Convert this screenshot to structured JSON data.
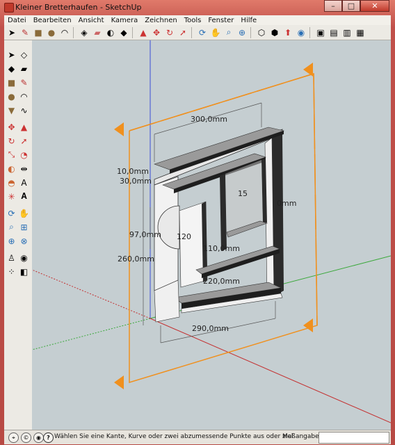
{
  "window": {
    "title": "Kleiner Bretterhaufen - SketchUp",
    "min": "–",
    "max": "□",
    "close": "✕"
  },
  "menu": [
    "Datei",
    "Bearbeiten",
    "Ansicht",
    "Kamera",
    "Zeichnen",
    "Tools",
    "Fenster",
    "Hilfe"
  ],
  "dimensions": {
    "width_top": "300,0mm",
    "thickness": "10,0mm",
    "offset": "30,0mm",
    "height_inner": "97,0mm",
    "height_total": "260,0mm",
    "depth": "120",
    "inner_width": "110,0mm",
    "shelf_width": "220,0mm",
    "width_bottom": "290,0mm",
    "right_partial": "0mm",
    "mid_partial": "15"
  },
  "status": {
    "text": "Wählen Sie eine Kante, Kurve oder zwei abzumessende Punkte aus oder ziel",
    "measure_label": "Maßangaben",
    "measure_value": ""
  }
}
